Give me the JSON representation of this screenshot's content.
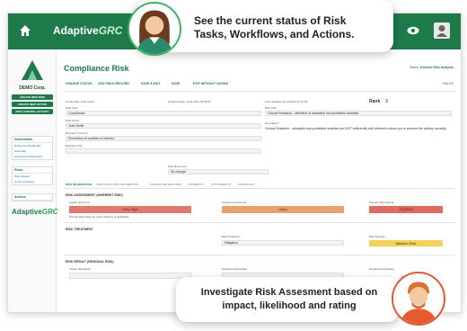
{
  "callouts": {
    "top_line1": "See the current status of Risk",
    "top_line2": "Tasks, Workflows, and Actions.",
    "bottom_line1": "Investigate Risk Assesment based on",
    "bottom_line2": "impact, likelihood and rating"
  },
  "topbar": {
    "brand": "Adaptive",
    "brand_suffix": "GRC",
    "home_icon": "home-icon",
    "eye_icon": "eye-icon",
    "user_icon": "user-icon",
    "color": "#1f7a4a"
  },
  "sidebar": {
    "org_name": "DEMO Corp.",
    "buttons": [
      "CREATE NEW RISK",
      "CREATE NEW ACTION",
      "NEW CONTROL ACTIVITY"
    ],
    "groups": [
      {
        "title": "Dashboards",
        "items": [
          "Enterprise Dashboard",
          "Heat Map",
          "Operational Dashboard"
        ]
      },
      {
        "title": "Risks",
        "items": [
          "Risk Register",
          "Control Activities"
        ]
      },
      {
        "title": "Actions",
        "items": []
      }
    ],
    "logo_brand": "Adaptive",
    "logo_suffix": "GRC"
  },
  "page": {
    "title": "Compliance Risk",
    "status_label": "Status:",
    "status_value": "Inherent Risk Analysis",
    "actions": [
      "CHANGE STATUS",
      "ADD FIELD RECORD",
      "SAVE & EXIT",
      "SAVE",
      "EXIT WITHOUT SAVING"
    ],
    "rules_label": "RULES"
  },
  "form": {
    "created_by": "Created By: John Smith",
    "creation_date": "Creation Date: 11.04.2021 09:25:05",
    "last_updated": "Last Updated: 30.04.2022 22:31:18",
    "rank_label": "Rank",
    "rank_value": "2",
    "risk_type_label": "Risk Type*",
    "risk_type_value": "Compliance",
    "risk_owner_label": "Risk Owner",
    "risk_owner_value": "John Smith",
    "business_process_label": "Business Process*",
    "business_process_value": "Prevention of conflicts of interest;",
    "business_unit_label": "Business Unit",
    "risk_title_label": "Risk Title*",
    "risk_title_value": "Clinical Research - definition of allowable and prohibited activities",
    "description_label": "Description*",
    "description_value": "Clinical Research - allowable and prohibited activities are NOT sufficiently well defined to allow you to execute the activity correctly.",
    "risk_movement_label": "Risk Movement",
    "risk_movement_value": "No change"
  },
  "tabs": [
    "RISK INFORMATION",
    "ADDITIONAL RISK INFORMATION",
    "ASSOCIATED RECORDS",
    "COMMENTS",
    "ATTACHMENTS",
    "WORKFLOW"
  ],
  "assessment": {
    "inherent_title": "RISK ASSESSMENT (INHERENT RISK)",
    "impact_label": "Impact (Inherent)",
    "impact_value": "Very High",
    "likelihood_label": "Likelihood (Inherent)",
    "likelihood_value": "Likely",
    "rating_label": "Inherent Risk Rating",
    "rating_value": "15 (Red)",
    "no_value_note": "Provide Risk Value for each category is applicable",
    "treatment_title": "RISK TREATMENT",
    "treatment_label": "Risk Treatment",
    "treatment_value": "Mitigation",
    "appetite_label": "Risk Appetite",
    "appetite_value": "Medium Risk",
    "residual_title": "RISK RESULT (RESIDUAL RISK)",
    "residual_impact_label": "Impact (Residual)",
    "residual_likelihood_label": "Likelihood (Residual)",
    "residual_rating_label": "Residual Risk Rating",
    "residual_rating_value": "N/A",
    "colors": {
      "impact": "#e07a6e",
      "likelihood": "#e8a070",
      "rating": "#e06a5e",
      "appetite": "#f5d35a"
    }
  }
}
